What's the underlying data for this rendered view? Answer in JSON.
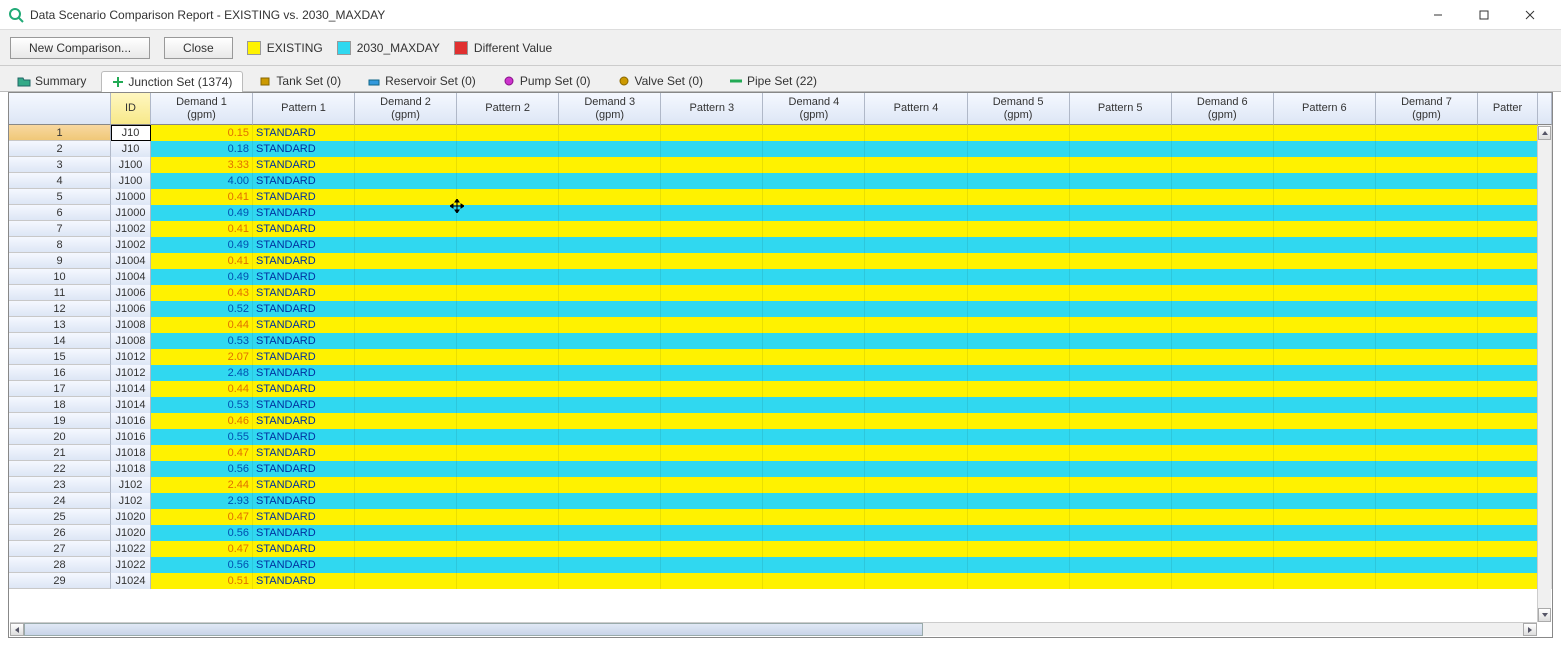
{
  "window": {
    "title": "Data Scenario Comparison Report - EXISTING vs. 2030_MAXDAY"
  },
  "toolbar": {
    "new_comparison": "New Comparison...",
    "close": "Close"
  },
  "legend": {
    "existing": "EXISTING",
    "maxday": "2030_MAXDAY",
    "different": "Different Value"
  },
  "tabs": [
    {
      "label": "Summary",
      "icon": "folder-icon",
      "active": false
    },
    {
      "label": "Junction Set (1374)",
      "icon": "plus-icon",
      "active": true
    },
    {
      "label": "Tank Set (0)",
      "icon": "tank-icon",
      "active": false
    },
    {
      "label": "Reservoir Set (0)",
      "icon": "reservoir-icon",
      "active": false
    },
    {
      "label": "Pump Set (0)",
      "icon": "pump-icon",
      "active": false
    },
    {
      "label": "Valve Set (0)",
      "icon": "valve-icon",
      "active": false
    },
    {
      "label": "Pipe Set (22)",
      "icon": "pipe-icon",
      "active": false
    }
  ],
  "columns": [
    "",
    "ID",
    "Demand 1\n(gpm)",
    "Pattern 1",
    "Demand 2\n(gpm)",
    "Pattern 2",
    "Demand 3\n(gpm)",
    "Pattern 3",
    "Demand 4\n(gpm)",
    "Pattern 4",
    "Demand 5\n(gpm)",
    "Pattern 5",
    "Demand 6\n(gpm)",
    "Pattern 6",
    "Demand 7\n(gpm)",
    "Patter"
  ],
  "rows": [
    {
      "n": 1,
      "id": "J10",
      "d": "0.15",
      "p": "STANDARD",
      "s": "y",
      "sel": true
    },
    {
      "n": 2,
      "id": "J10",
      "d": "0.18",
      "p": "STANDARD",
      "s": "c"
    },
    {
      "n": 3,
      "id": "J100",
      "d": "3.33",
      "p": "STANDARD",
      "s": "y"
    },
    {
      "n": 4,
      "id": "J100",
      "d": "4.00",
      "p": "STANDARD",
      "s": "c"
    },
    {
      "n": 5,
      "id": "J1000",
      "d": "0.41",
      "p": "STANDARD",
      "s": "y"
    },
    {
      "n": 6,
      "id": "J1000",
      "d": "0.49",
      "p": "STANDARD",
      "s": "c"
    },
    {
      "n": 7,
      "id": "J1002",
      "d": "0.41",
      "p": "STANDARD",
      "s": "y"
    },
    {
      "n": 8,
      "id": "J1002",
      "d": "0.49",
      "p": "STANDARD",
      "s": "c"
    },
    {
      "n": 9,
      "id": "J1004",
      "d": "0.41",
      "p": "STANDARD",
      "s": "y"
    },
    {
      "n": 10,
      "id": "J1004",
      "d": "0.49",
      "p": "STANDARD",
      "s": "c"
    },
    {
      "n": 11,
      "id": "J1006",
      "d": "0.43",
      "p": "STANDARD",
      "s": "y"
    },
    {
      "n": 12,
      "id": "J1006",
      "d": "0.52",
      "p": "STANDARD",
      "s": "c"
    },
    {
      "n": 13,
      "id": "J1008",
      "d": "0.44",
      "p": "STANDARD",
      "s": "y"
    },
    {
      "n": 14,
      "id": "J1008",
      "d": "0.53",
      "p": "STANDARD",
      "s": "c"
    },
    {
      "n": 15,
      "id": "J1012",
      "d": "2.07",
      "p": "STANDARD",
      "s": "y"
    },
    {
      "n": 16,
      "id": "J1012",
      "d": "2.48",
      "p": "STANDARD",
      "s": "c"
    },
    {
      "n": 17,
      "id": "J1014",
      "d": "0.44",
      "p": "STANDARD",
      "s": "y"
    },
    {
      "n": 18,
      "id": "J1014",
      "d": "0.53",
      "p": "STANDARD",
      "s": "c"
    },
    {
      "n": 19,
      "id": "J1016",
      "d": "0.46",
      "p": "STANDARD",
      "s": "y"
    },
    {
      "n": 20,
      "id": "J1016",
      "d": "0.55",
      "p": "STANDARD",
      "s": "c"
    },
    {
      "n": 21,
      "id": "J1018",
      "d": "0.47",
      "p": "STANDARD",
      "s": "y"
    },
    {
      "n": 22,
      "id": "J1018",
      "d": "0.56",
      "p": "STANDARD",
      "s": "c"
    },
    {
      "n": 23,
      "id": "J102",
      "d": "2.44",
      "p": "STANDARD",
      "s": "y"
    },
    {
      "n": 24,
      "id": "J102",
      "d": "2.93",
      "p": "STANDARD",
      "s": "c"
    },
    {
      "n": 25,
      "id": "J1020",
      "d": "0.47",
      "p": "STANDARD",
      "s": "y"
    },
    {
      "n": 26,
      "id": "J1020",
      "d": "0.56",
      "p": "STANDARD",
      "s": "c"
    },
    {
      "n": 27,
      "id": "J1022",
      "d": "0.47",
      "p": "STANDARD",
      "s": "y"
    },
    {
      "n": 28,
      "id": "J1022",
      "d": "0.56",
      "p": "STANDARD",
      "s": "c"
    },
    {
      "n": 29,
      "id": "J1024",
      "d": "0.51",
      "p": "STANDARD",
      "s": "y"
    }
  ]
}
